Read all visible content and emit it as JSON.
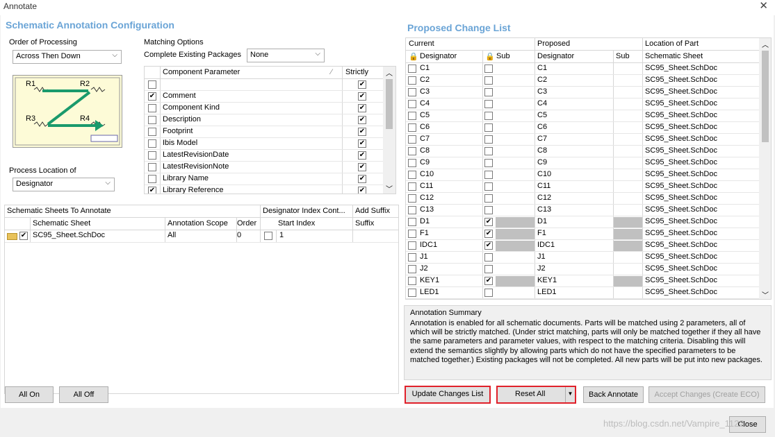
{
  "window": {
    "title": "Annotate",
    "close_glyph": "✕"
  },
  "left": {
    "heading": "Schematic Annotation Configuration",
    "order": {
      "label": "Order of Processing",
      "value": "Across Then Down"
    },
    "diagram": {
      "labels": [
        "R1",
        "R2",
        "R3",
        "R4"
      ]
    },
    "process": {
      "label": "Process Location of",
      "value": "Designator"
    },
    "matching": {
      "label": "Matching Options",
      "complete_label": "Complete Existing Packages",
      "complete_value": "None",
      "col_param": "Component Parameter",
      "col_strictly": "Strictly",
      "rows": [
        {
          "name": "",
          "checked": false,
          "strict": true
        },
        {
          "name": "Comment",
          "checked": true,
          "strict": true
        },
        {
          "name": "Component Kind",
          "checked": false,
          "strict": true
        },
        {
          "name": "Description",
          "checked": false,
          "strict": true
        },
        {
          "name": "Footprint",
          "checked": false,
          "strict": true
        },
        {
          "name": "Ibis Model",
          "checked": false,
          "strict": true
        },
        {
          "name": "LatestRevisionDate",
          "checked": false,
          "strict": true
        },
        {
          "name": "LatestRevisionNote",
          "checked": false,
          "strict": true
        },
        {
          "name": "Library Name",
          "checked": false,
          "strict": true
        },
        {
          "name": "Library Reference",
          "checked": true,
          "strict": true
        }
      ]
    },
    "sheets": {
      "group1": "Schematic Sheets To Annotate",
      "group2": "Designator Index Cont...",
      "group3": "Add Suffix",
      "cols": [
        "Schematic Sheet",
        "Annotation Scope",
        "Order",
        "Start Index",
        "Suffix"
      ],
      "row": {
        "sheet": "SC95_Sheet.SchDoc",
        "scope": "All",
        "order": "0",
        "start": "1"
      }
    },
    "btn_all_on": "All On",
    "btn_all_off": "All Off"
  },
  "right": {
    "heading": "Proposed Change List",
    "groups": [
      "Current",
      "Proposed",
      "Location of Part"
    ],
    "cols": [
      "Designator",
      "Sub",
      "Designator",
      "Sub",
      "Schematic Sheet"
    ],
    "rows": [
      {
        "cur": "C1",
        "sub": false,
        "prop": "C1",
        "sheet": "SC95_Sheet.SchDoc"
      },
      {
        "cur": "C2",
        "sub": false,
        "prop": "C2",
        "sheet": "SC95_Sheet.SchDoc"
      },
      {
        "cur": "C3",
        "sub": false,
        "prop": "C3",
        "sheet": "SC95_Sheet.SchDoc"
      },
      {
        "cur": "C4",
        "sub": false,
        "prop": "C4",
        "sheet": "SC95_Sheet.SchDoc"
      },
      {
        "cur": "C5",
        "sub": false,
        "prop": "C5",
        "sheet": "SC95_Sheet.SchDoc"
      },
      {
        "cur": "C6",
        "sub": false,
        "prop": "C6",
        "sheet": "SC95_Sheet.SchDoc"
      },
      {
        "cur": "C7",
        "sub": false,
        "prop": "C7",
        "sheet": "SC95_Sheet.SchDoc"
      },
      {
        "cur": "C8",
        "sub": false,
        "prop": "C8",
        "sheet": "SC95_Sheet.SchDoc"
      },
      {
        "cur": "C9",
        "sub": false,
        "prop": "C9",
        "sheet": "SC95_Sheet.SchDoc"
      },
      {
        "cur": "C10",
        "sub": false,
        "prop": "C10",
        "sheet": "SC95_Sheet.SchDoc"
      },
      {
        "cur": "C11",
        "sub": false,
        "prop": "C11",
        "sheet": "SC95_Sheet.SchDoc"
      },
      {
        "cur": "C12",
        "sub": false,
        "prop": "C12",
        "sheet": "SC95_Sheet.SchDoc"
      },
      {
        "cur": "C13",
        "sub": false,
        "prop": "C13",
        "sheet": "SC95_Sheet.SchDoc"
      },
      {
        "cur": "D1",
        "sub": true,
        "prop": "D1",
        "sheet": "SC95_Sheet.SchDoc"
      },
      {
        "cur": "F1",
        "sub": true,
        "prop": "F1",
        "sheet": "SC95_Sheet.SchDoc"
      },
      {
        "cur": "IDC1",
        "sub": true,
        "prop": "IDC1",
        "sheet": "SC95_Sheet.SchDoc"
      },
      {
        "cur": "J1",
        "sub": false,
        "prop": "J1",
        "sheet": "SC95_Sheet.SchDoc"
      },
      {
        "cur": "J2",
        "sub": false,
        "prop": "J2",
        "sheet": "SC95_Sheet.SchDoc"
      },
      {
        "cur": "KEY1",
        "sub": true,
        "prop": "KEY1",
        "sheet": "SC95_Sheet.SchDoc"
      },
      {
        "cur": "LED1",
        "sub": false,
        "prop": "LED1",
        "sheet": "SC95_Sheet.SchDoc"
      }
    ],
    "summary_title": "Annotation Summary",
    "summary_text": "Annotation is enabled for all schematic documents. Parts will be matched using 2 parameters, all of which will be strictly matched. (Under strict matching, parts will only be matched together if they all have the same parameters and parameter values, with respect to the matching criteria. Disabling this will extend the semantics slightly by allowing parts which do not have the specified parameters to be matched together.) Existing packages will not be completed. All new parts will be put into new packages.",
    "btn_update": "Update Changes List",
    "btn_reset": "Reset All",
    "btn_back": "Back Annotate",
    "btn_accept": "Accept Changes (Create ECO)"
  },
  "footer": {
    "btn_close": "Close",
    "watermark": "https://blog.csdn.net/Vampire_1122"
  }
}
